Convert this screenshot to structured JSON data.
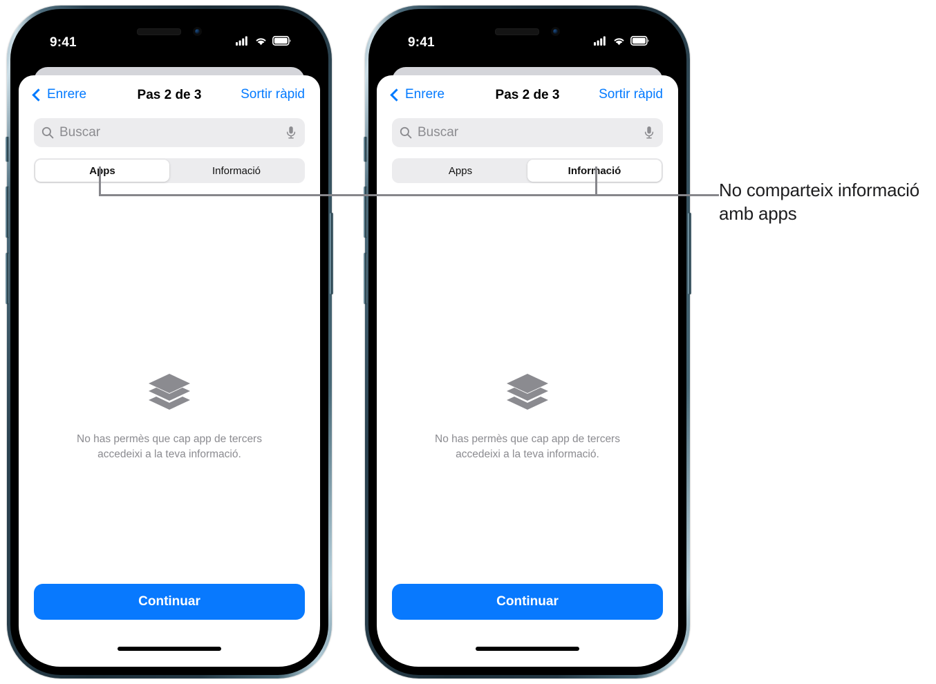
{
  "figure": {
    "callout": {
      "text": "No comparteix informació amb apps"
    }
  },
  "phones": [
    {
      "id": "phone-left",
      "status_bar": {
        "time": "9:41",
        "icons": [
          "cellular-signal-icon",
          "wifi-icon",
          "battery-icon"
        ]
      },
      "nav": {
        "back_label": "Enrere",
        "title": "Pas 2 de 3",
        "right_label": "Sortir ràpid"
      },
      "search": {
        "placeholder": "Buscar",
        "value": "",
        "leading_icon": "search-icon",
        "trailing_icon": "microphone-icon"
      },
      "segmented": {
        "options": [
          "Apps",
          "Informació"
        ],
        "selected": "Apps",
        "selected_index": 0
      },
      "empty_state": {
        "icon": "stack-layers-icon",
        "message": "No has permès que cap app de tercers accedeixi a la teva informació."
      },
      "primary_button": "Continuar"
    },
    {
      "id": "phone-right",
      "status_bar": {
        "time": "9:41",
        "icons": [
          "cellular-signal-icon",
          "wifi-icon",
          "battery-icon"
        ]
      },
      "nav": {
        "back_label": "Enrere",
        "title": "Pas 2 de 3",
        "right_label": "Sortir ràpid"
      },
      "search": {
        "placeholder": "Buscar",
        "value": "",
        "leading_icon": "search-icon",
        "trailing_icon": "microphone-icon"
      },
      "segmented": {
        "options": [
          "Apps",
          "Informació"
        ],
        "selected": "Informació",
        "selected_index": 1
      },
      "empty_state": {
        "icon": "stack-layers-icon",
        "message": "No has permès que cap app de tercers accedeixi a la teva informació."
      },
      "primary_button": "Continuar"
    }
  ],
  "colors": {
    "accent_blue": "#0879FE",
    "link_blue": "#037AFF",
    "field_gray": "#ececee",
    "muted_text": "#8b8b90",
    "callout_line": "#86868b"
  }
}
